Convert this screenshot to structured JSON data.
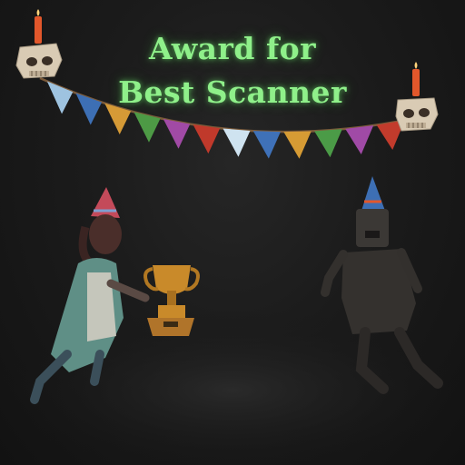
{
  "title": {
    "line1": "Award for",
    "line2": "Best Scanner"
  },
  "colors": {
    "title_glow": "#8ff08a",
    "background": "#1b1b1b",
    "candle": "#e2572b",
    "skull": "#d9cbb4",
    "trophy": "#c98a2a",
    "string": "#7a5a3a"
  },
  "bunting": {
    "flag_colors": [
      "#9ec3e0",
      "#3d6fb4",
      "#d59a36",
      "#4d9a45",
      "#a14aa5",
      "#c0392b",
      "#cfe3f0",
      "#3f71b8",
      "#d69b34",
      "#4b9b47",
      "#a04aa6",
      "#c23b2c"
    ]
  },
  "scene_objects": {
    "left_skull_candle": "skull-candle",
    "right_skull_candle": "skull-candle",
    "left_character": "zombie-woman-with-party-hat",
    "right_character": "zombie-man-with-party-hat",
    "prop": "trophy"
  }
}
